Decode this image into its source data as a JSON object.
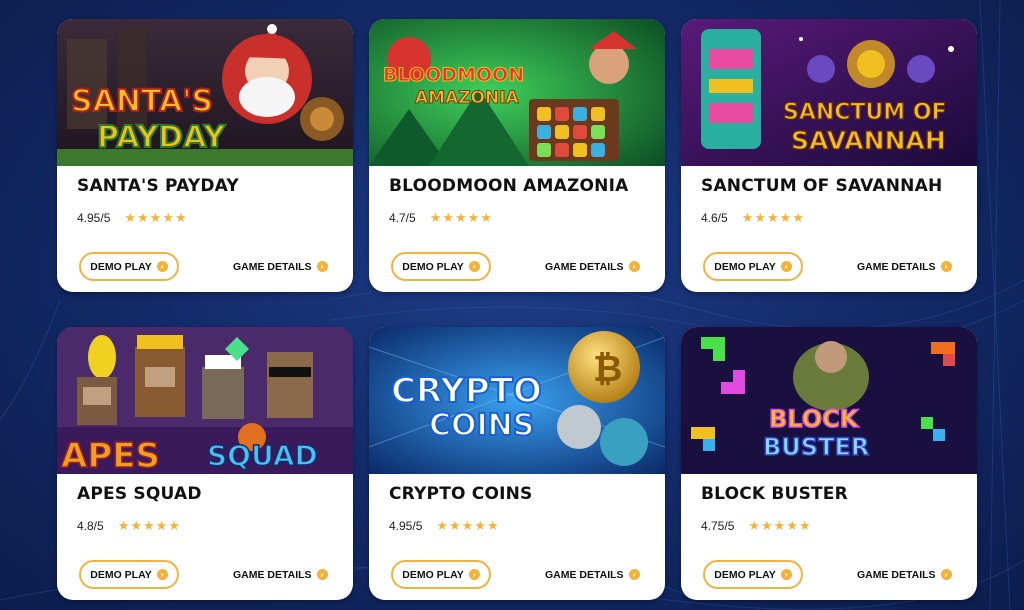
{
  "games": [
    {
      "title": "SANTA'S PAYDAY",
      "rating": "4.95/5",
      "stars": "★★★★★",
      "demo_label": "DEMO PLAY",
      "details_label": "GAME DETAILS",
      "logo_line1": "SANTA'S",
      "logo_line2": "PAYDAY"
    },
    {
      "title": "BLOODMOON AMAZONIA",
      "rating": "4.7/5",
      "stars": "★★★★★",
      "demo_label": "DEMO PLAY",
      "details_label": "GAME DETAILS",
      "logo_line1": "BLOODMOON",
      "logo_line2": "AMAZONIA"
    },
    {
      "title": "SANCTUM OF SAVANNAH",
      "rating": "4.6/5",
      "stars": "★★★★★",
      "demo_label": "DEMO PLAY",
      "details_label": "GAME DETAILS",
      "logo_line1": "SANCTUM OF",
      "logo_line2": "SAVANNAH"
    },
    {
      "title": "APES SQUAD",
      "rating": "4.8/5",
      "stars": "★★★★★",
      "demo_label": "DEMO PLAY",
      "details_label": "GAME DETAILS",
      "logo_line1": "APES",
      "logo_line2": "SQUAD"
    },
    {
      "title": "CRYPTO COINS",
      "rating": "4.95/5",
      "stars": "★★★★★",
      "demo_label": "DEMO PLAY",
      "details_label": "GAME DETAILS",
      "logo_line1": "CRYPTO",
      "logo_line2": "COINS"
    },
    {
      "title": "BLOCK BUSTER",
      "rating": "4.75/5",
      "stars": "★★★★★",
      "demo_label": "DEMO PLAY",
      "details_label": "GAME DETAILS",
      "logo_line1": "BLOCK",
      "logo_line2": "BUSTER"
    }
  ],
  "colors": {
    "accent": "#f2b33d",
    "background": "#142c6b",
    "card": "#ffffff"
  }
}
